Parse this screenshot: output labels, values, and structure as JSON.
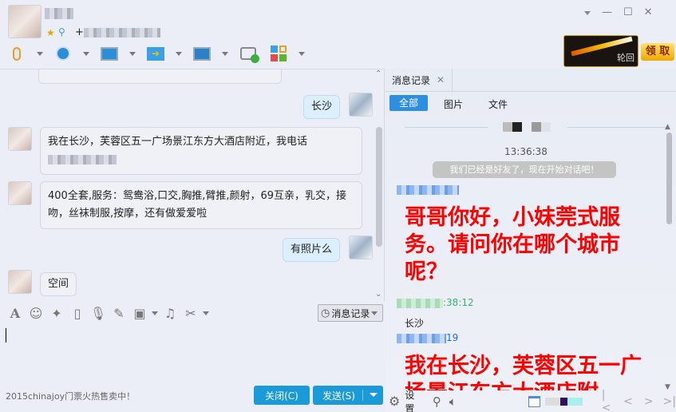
{
  "header": {
    "contact_name": "(blurred)",
    "contact_info_prefix": "+",
    "window_controls": [
      "menu-down",
      "minimize",
      "maximize",
      "close"
    ],
    "promo": {
      "caption": "轮回",
      "button": "领 取"
    },
    "toolbar": [
      "microphone",
      "camera",
      "screen-share",
      "file-transfer",
      "remote-desktop",
      "new-chat",
      "apps"
    ]
  },
  "chat": {
    "messages": [
      {
        "side": "right",
        "text": "长沙"
      },
      {
        "side": "left",
        "text": "我在长沙，芙蓉区五一广场景江东方大酒店附近，我电话"
      },
      {
        "side": "left",
        "text": "400全套,服务：鸳鸯浴,口交,胸推,臂推,颜射，69互亲，乳交，接吻，丝袜制服,按摩，还有做爱爱啦"
      },
      {
        "side": "right",
        "text": "有照片么"
      },
      {
        "side": "left",
        "text": "空间"
      }
    ]
  },
  "input": {
    "tools": [
      "font",
      "emoji",
      "magic",
      "shake",
      "voice",
      "note",
      "image",
      "music",
      "screenshot"
    ],
    "history_button": "消息记录",
    "value": "",
    "ad_text": "2015chinajoy门票火热售卖中！",
    "close_button": "关闭(C)",
    "send_button": "发送(S)"
  },
  "history": {
    "tab_label": "消息记录",
    "filters": [
      {
        "label": "全部",
        "active": true
      },
      {
        "label": "图片",
        "active": false
      },
      {
        "label": "文件",
        "active": false
      }
    ],
    "time1": "13:36:38",
    "system_msg": "我们已经是好友了，现在开始对话吧！",
    "msg1": "哥哥你好，小妹莞式服务。请问你在哪个城市呢？",
    "time2_suffix": ":38:12",
    "msg2": "长沙",
    "time3_suffix": "19",
    "msg3": "我在长沙，芙蓉区五一广场景江东方大酒店附",
    "settings_label": "设置"
  },
  "colors": {
    "accent": "#1a9ad8",
    "filter_active": "#2d8fe0",
    "ad_red": "#ff0000",
    "time_green": "#3cb371"
  }
}
